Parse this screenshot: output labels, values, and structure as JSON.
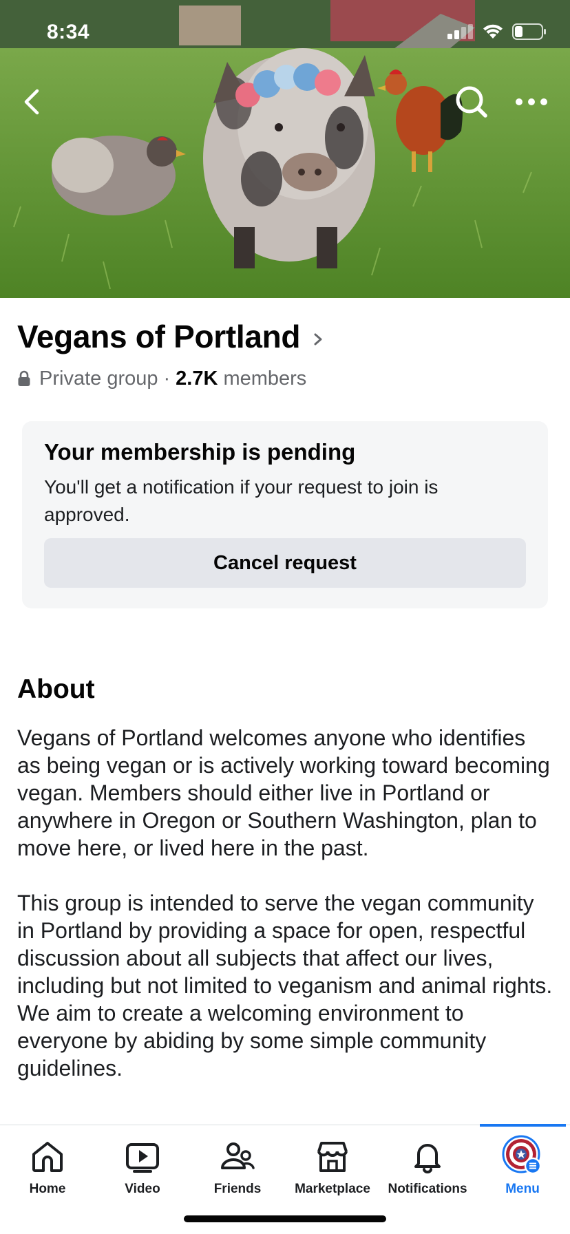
{
  "status_bar": {
    "time": "8:34"
  },
  "group": {
    "name": "Vegans of Portland",
    "privacy": "Private group",
    "separator": "·",
    "member_count": "2.7K",
    "member_label": "members"
  },
  "membership": {
    "title": "Your membership is pending",
    "description": "You'll get a notification if your request to join is approved.",
    "cancel_label": "Cancel request"
  },
  "about": {
    "heading": "About",
    "paragraphs": [
      "Vegans of Portland welcomes anyone who identifies as being vegan or is actively working toward becoming vegan. Members should either live in Portland or anywhere in Oregon or Southern Washington, plan to move here, or lived here in the past.",
      "This group is intended to serve the vegan community in Portland by providing a space for open, respectful discussion about all subjects that affect our lives, including but not limited to veganism and animal rights. We aim to create a welcoming environment to everyone by abiding by some simple community guidelines."
    ]
  },
  "tabs": [
    {
      "label": "Home",
      "icon": "home-icon"
    },
    {
      "label": "Video",
      "icon": "video-icon"
    },
    {
      "label": "Friends",
      "icon": "friends-icon"
    },
    {
      "label": "Marketplace",
      "icon": "marketplace-icon"
    },
    {
      "label": "Notifications",
      "icon": "bell-icon"
    },
    {
      "label": "Menu",
      "icon": "profile-avatar-icon",
      "active": true
    }
  ],
  "colors": {
    "accent": "#1877f2",
    "text_primary": "#050505",
    "text_secondary": "#65676b",
    "card_bg": "#f5f6f7",
    "button_bg": "#e4e6eb"
  }
}
